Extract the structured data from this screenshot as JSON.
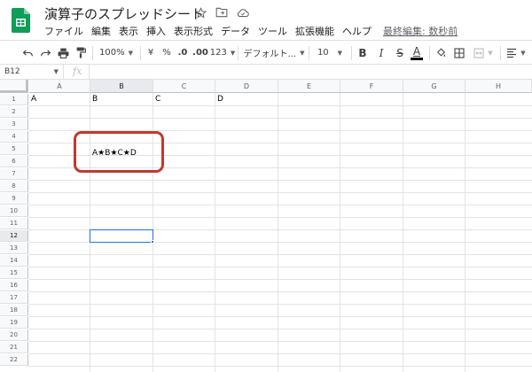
{
  "document": {
    "title": "演算子のスプレッドシート",
    "menu": [
      "ファイル",
      "編集",
      "表示",
      "挿入",
      "表示形式",
      "データ",
      "ツール",
      "拡張機能",
      "ヘルプ"
    ],
    "last_edit": "最終編集: 数秒前"
  },
  "toolbar": {
    "zoom": "100%",
    "currency": "¥",
    "percent": "%",
    "decrease_decimal": ".0",
    "increase_decimal": ".00",
    "more_formats": "123",
    "font": "デフォルト...",
    "font_size": "10",
    "bold": "B",
    "italic": "I",
    "strikethrough": "S",
    "text_color": "A"
  },
  "formula_bar": {
    "cell_ref": "B12",
    "fx_label": "fx",
    "content": ""
  },
  "grid": {
    "columns": [
      "A",
      "B",
      "C",
      "D",
      "E",
      "F",
      "G",
      "H"
    ],
    "rows": [
      "1",
      "2",
      "3",
      "4",
      "5",
      "6",
      "7",
      "8",
      "9",
      "10",
      "11",
      "12",
      "13",
      "14",
      "15",
      "16",
      "17",
      "18",
      "19",
      "20",
      "21",
      "22"
    ],
    "selected_cell": "B12",
    "cells": {
      "A1": "A",
      "B1": "B",
      "C1": "C",
      "D1": "D",
      "B5": "A★B★C★D"
    }
  },
  "colors": {
    "sheets_green": "#0f9d58",
    "selection_blue": "#1a73e8",
    "annotation_red": "#c0392b"
  }
}
